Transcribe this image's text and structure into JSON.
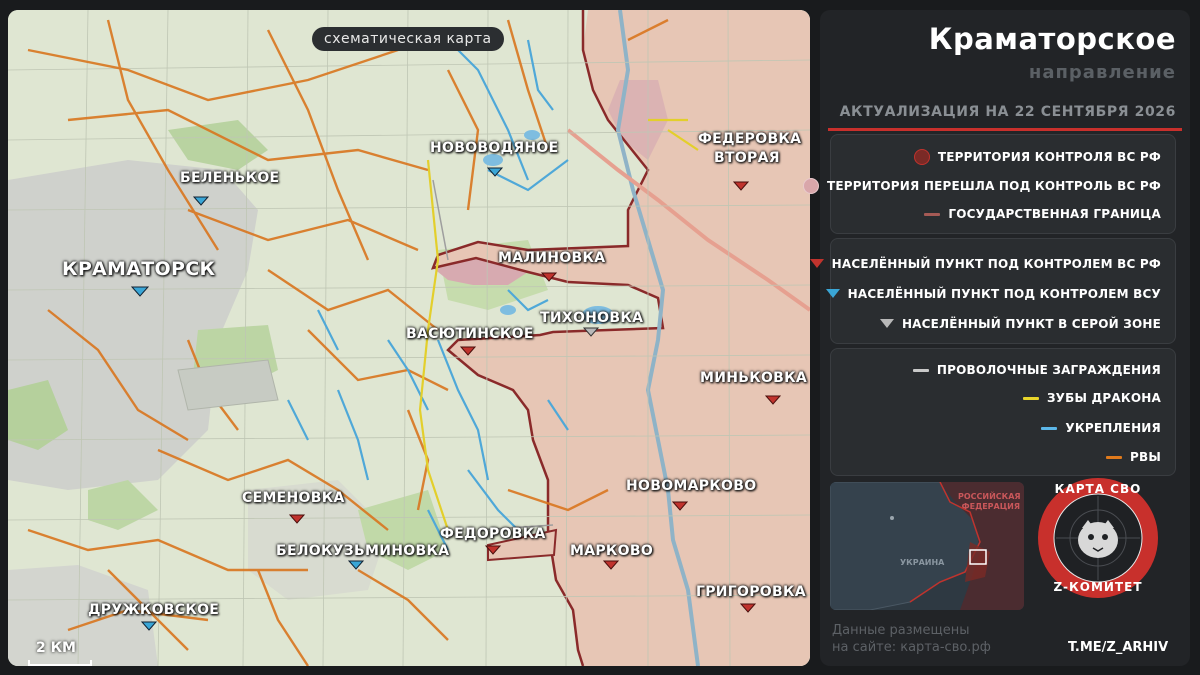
{
  "map": {
    "caption": "схематическая карта",
    "scale_label": "2 КМ",
    "labels": {
      "kramatorsk": "КРАМАТОРСК",
      "belenkoe": "БЕЛЕНЬКОЕ",
      "novovodyanoe": "НОВОВОДЯНОЕ",
      "fedorovka_vtoraya_1": "ФЕДЕРОВКА",
      "fedorovka_vtoraya_2": "ВТОРАЯ",
      "malinovka": "МАЛИНОВКА",
      "tikhonovka": "ТИХОНОВКА",
      "vasyutinskoe": "ВАСЮТИНСКОЕ",
      "minkovka": "МИНЬКОВКА",
      "novomarkovo": "НОВОМАРКОВО",
      "semenovka": "СЕМЕНОВКА",
      "fedorovka": "ФЕДОРОВКА",
      "belokuzminovka": "БЕЛОКУЗЬМИНОВКА",
      "markovo": "МАРКОВО",
      "grigorovka": "ГРИГОРОВКА",
      "druzhkovskoe": "ДРУЖКОВСКОЕ"
    },
    "settlement_markers": [
      {
        "name": "kramatorsk",
        "status": "ua"
      },
      {
        "name": "belenkoe",
        "status": "ua"
      },
      {
        "name": "novovodyanoe",
        "status": "ua"
      },
      {
        "name": "fedorovka_vtoraya",
        "status": "ru"
      },
      {
        "name": "malinovka",
        "status": "ru"
      },
      {
        "name": "tikhonovka",
        "status": "gray"
      },
      {
        "name": "vasyutinskoe",
        "status": "ru"
      },
      {
        "name": "minkovka",
        "status": "ru"
      },
      {
        "name": "novomarkovo",
        "status": "ru"
      },
      {
        "name": "semenovka",
        "status": "ru"
      },
      {
        "name": "fedorovka",
        "status": "ru"
      },
      {
        "name": "belokuzminovka",
        "status": "ua"
      },
      {
        "name": "markovo",
        "status": "ru"
      },
      {
        "name": "grigorovka",
        "status": "ru"
      },
      {
        "name": "druzhkovskoe",
        "status": "ua"
      }
    ]
  },
  "panel": {
    "title": "Краматорское",
    "subtitle": "направление",
    "update": "АКТУАЛИЗАЦИЯ НА 22 СЕНТЯБРЯ 2026",
    "legend_territory": [
      {
        "label": "ТЕРРИТОРИЯ КОНТРОЛЯ ВС РФ",
        "color": "#7a2a26"
      },
      {
        "label": "ТЕРРИТОРИЯ ПЕРЕШЛА ПОД КОНТРОЛЬ ВС РФ",
        "color": "#d9a6aa"
      },
      {
        "label": "ГОСУДАРСТВЕННАЯ ГРАНИЦА",
        "color": "#a55a55"
      }
    ],
    "legend_settlements": [
      {
        "label": "НАСЕЛЁННЫЙ ПУНКТ ПОД КОНТРОЛЕМ ВС РФ",
        "color": "#c0332d"
      },
      {
        "label": "НАСЕЛЁННЫЙ ПУНКТ ПОД КОНТРОЛЕМ ВСУ",
        "color": "#3aa6d6"
      },
      {
        "label": "НАСЕЛЁННЫЙ ПУНКТ В СЕРОЙ ЗОНЕ",
        "color": "#b8b8b8"
      }
    ],
    "legend_fortifications": [
      {
        "label": "ПРОВОЛОЧНЫЕ ЗАГРАЖДЕНИЯ",
        "color": "#c9c9c9"
      },
      {
        "label": "ЗУБЫ ДРАКОНА",
        "color": "#e8d52a"
      },
      {
        "label": "УКРЕПЛЕНИЯ",
        "color": "#5cb7e8"
      },
      {
        "label": "РВЫ",
        "color": "#e07a1c"
      }
    ],
    "inset": {
      "label_russia_1": "РОССИЙСКАЯ",
      "label_russia_2": "ФЕДЕРАЦИЯ",
      "label_ukraine": "УКРАИНА"
    },
    "site_note_1": "Данные размещены",
    "site_note_2": "на сайте: карта-сво.рф",
    "logo_top": "КАРТА СВО",
    "logo_bottom": "Z-КОМИТЕТ",
    "tme": "T.ME/Z_ARHIV"
  },
  "colors": {
    "ru_territory": "#e8c4b4",
    "front_line": "#8a2a2a",
    "accent_red": "#c8302c"
  }
}
